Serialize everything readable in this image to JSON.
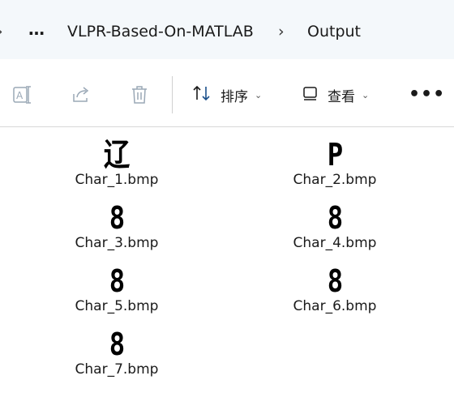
{
  "breadcrumb": {
    "overflow": "…",
    "items": [
      "VLPR-Based-On-MATLAB",
      "Output"
    ]
  },
  "toolbar": {
    "icons": [
      "rename-icon",
      "share-icon",
      "delete-icon"
    ],
    "sort_label": "排序",
    "view_label": "查看",
    "more": "•••"
  },
  "files": [
    {
      "name": "Char_1.bmp",
      "thumb": "辽"
    },
    {
      "name": "Char_2.bmp",
      "thumb": "P"
    },
    {
      "name": "Char_3.bmp",
      "thumb": "8"
    },
    {
      "name": "Char_4.bmp",
      "thumb": "8"
    },
    {
      "name": "Char_5.bmp",
      "thumb": "8"
    },
    {
      "name": "Char_6.bmp",
      "thumb": "8"
    },
    {
      "name": "Char_7.bmp",
      "thumb": "8"
    }
  ],
  "colors": {
    "address_bg": "#f4f8fb",
    "icon_disabled": "#9aa8b6"
  }
}
